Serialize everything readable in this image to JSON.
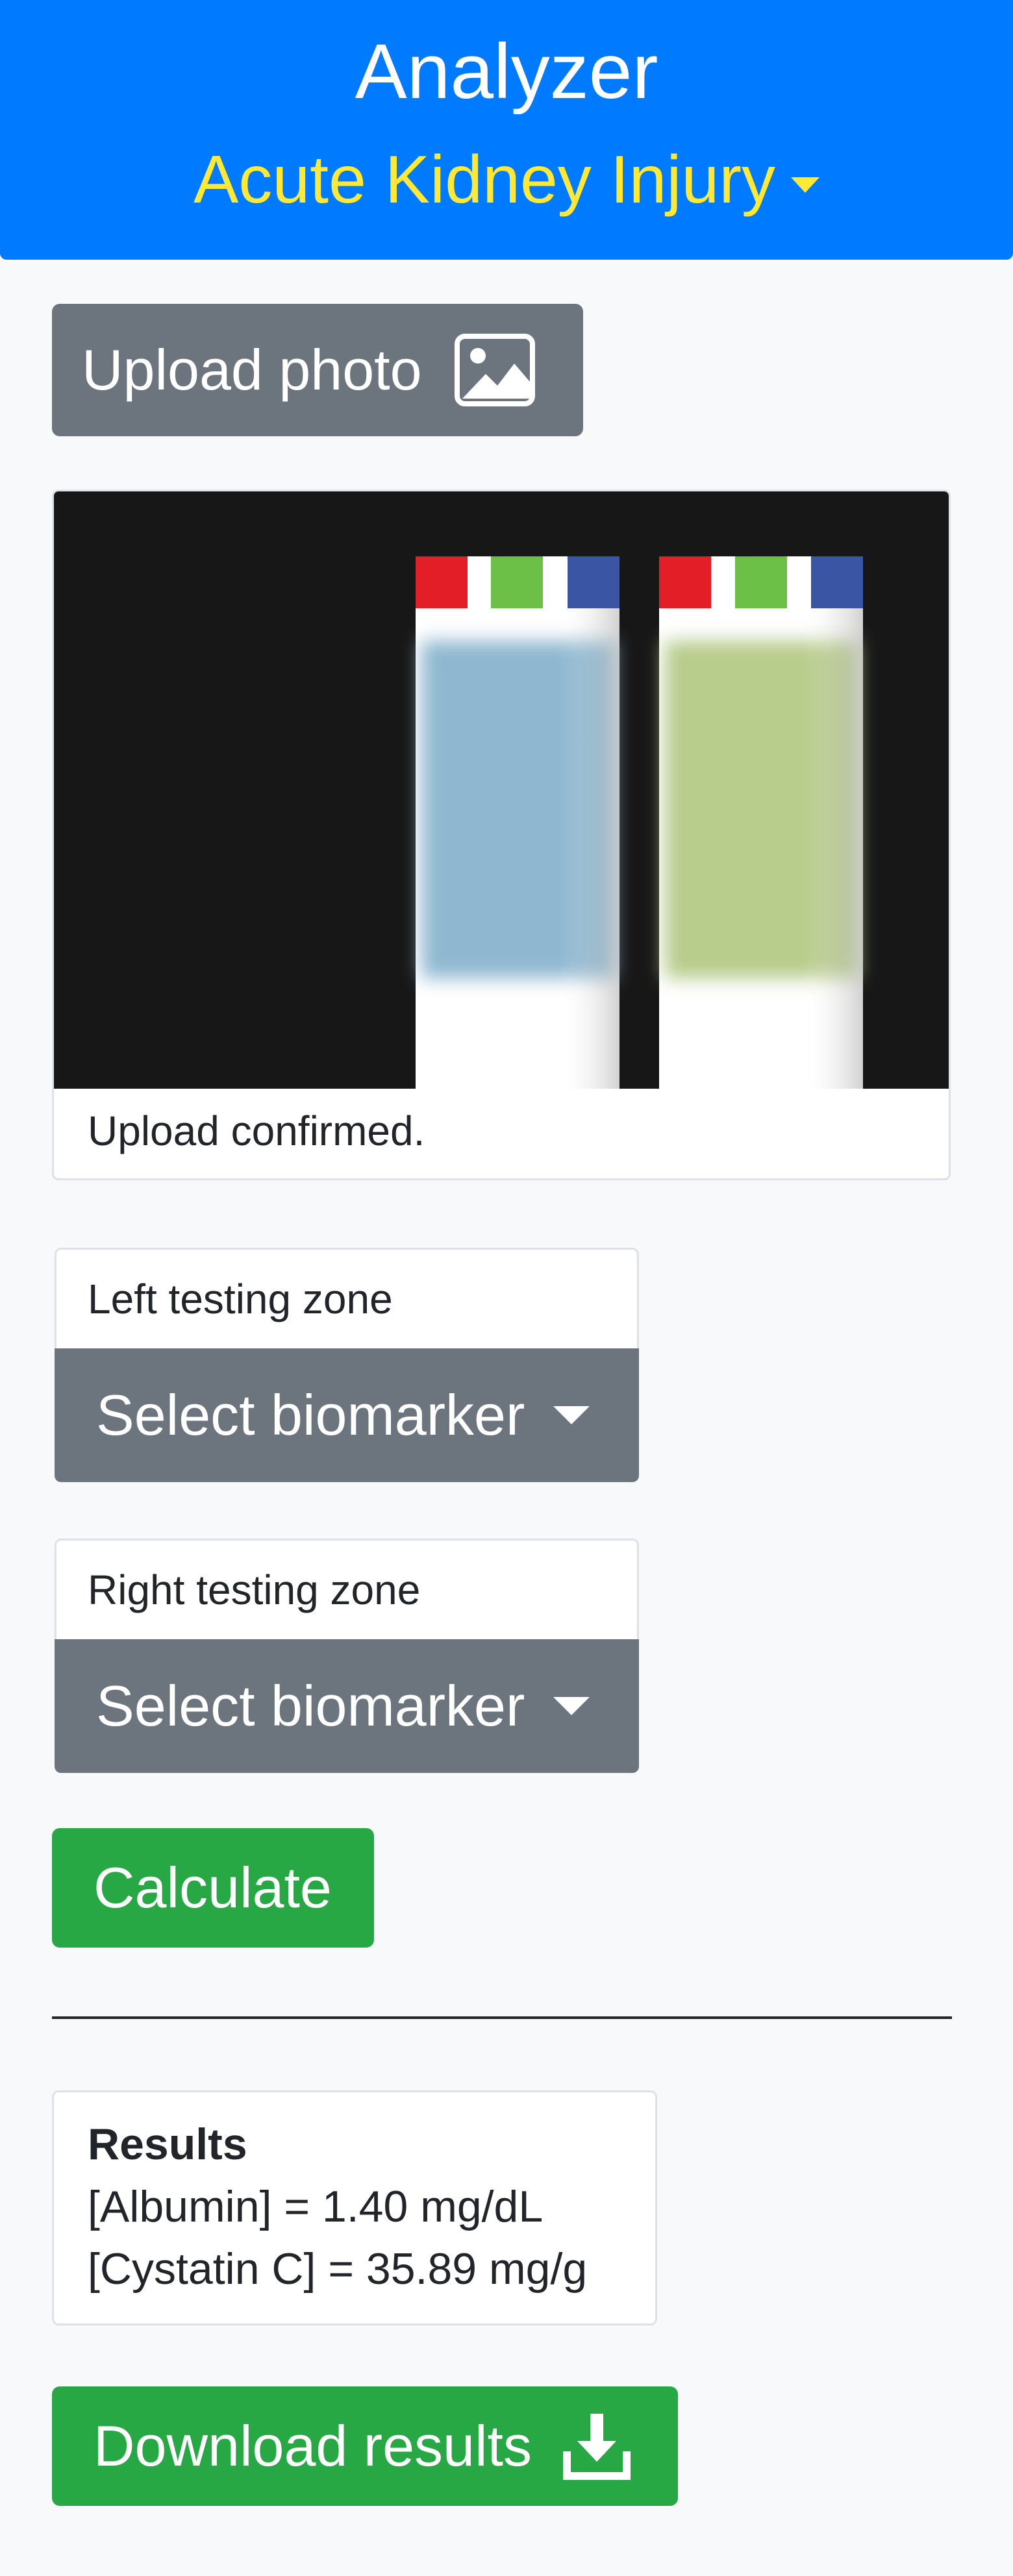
{
  "header": {
    "title": "Analyzer",
    "mode": "Acute Kidney Injury",
    "mode_icon": "caret-down-icon",
    "background_color": "#007bff",
    "mode_color": "#ffe936"
  },
  "upload": {
    "label": "Upload photo",
    "icon": "image-icon"
  },
  "preview": {
    "status": "Upload confirmed.",
    "strip_marker_colors": [
      "#e41e26",
      "#6cbf47",
      "#3a55a4"
    ],
    "left_strip_color": "#8fb8d0",
    "right_strip_color": "#b8cc8c"
  },
  "zones": {
    "left": {
      "label": "Left testing zone",
      "select_label": "Select biomarker"
    },
    "right": {
      "label": "Right testing zone",
      "select_label": "Select biomarker"
    }
  },
  "calculate": {
    "label": "Calculate"
  },
  "results": {
    "title": "Results",
    "lines": [
      "[Albumin] = 1.40 mg/dL",
      "[Cystatin C] = 35.89 mg/g"
    ]
  },
  "download": {
    "label": "Download results",
    "icon": "download-icon"
  }
}
